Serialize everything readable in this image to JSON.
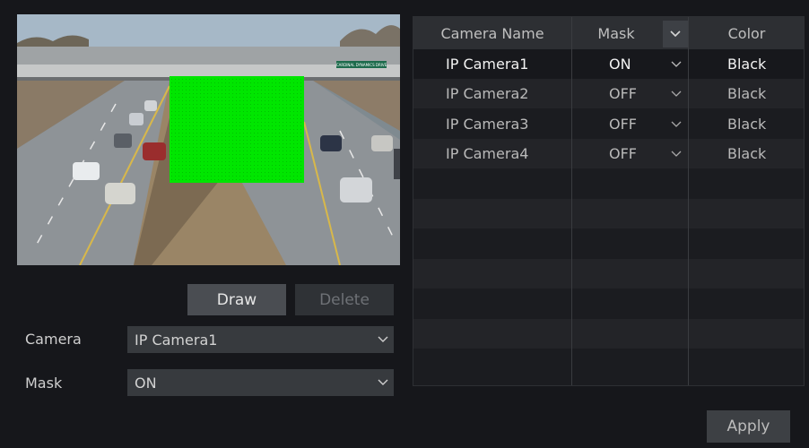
{
  "controls": {
    "draw_label": "Draw",
    "delete_label": "Delete",
    "camera_label": "Camera",
    "camera_value": "IP Camera1",
    "mask_label": "Mask",
    "mask_value": "ON",
    "apply_label": "Apply"
  },
  "preview": {
    "mask_color": "#00e600",
    "sign_text": "CARDINAL DYNAMICS DRIVE"
  },
  "table": {
    "headers": {
      "name": "Camera Name",
      "mask": "Mask",
      "color": "Color"
    },
    "rows": [
      {
        "name": "IP Camera1",
        "mask": "ON",
        "color": "Black"
      },
      {
        "name": "IP Camera2",
        "mask": "OFF",
        "color": "Black"
      },
      {
        "name": "IP Camera3",
        "mask": "OFF",
        "color": "Black"
      },
      {
        "name": "IP Camera4",
        "mask": "OFF",
        "color": "Black"
      }
    ]
  },
  "colors": {
    "background": "#16171b",
    "panel": "#2d2f33",
    "accent_mask": "#00e600"
  }
}
